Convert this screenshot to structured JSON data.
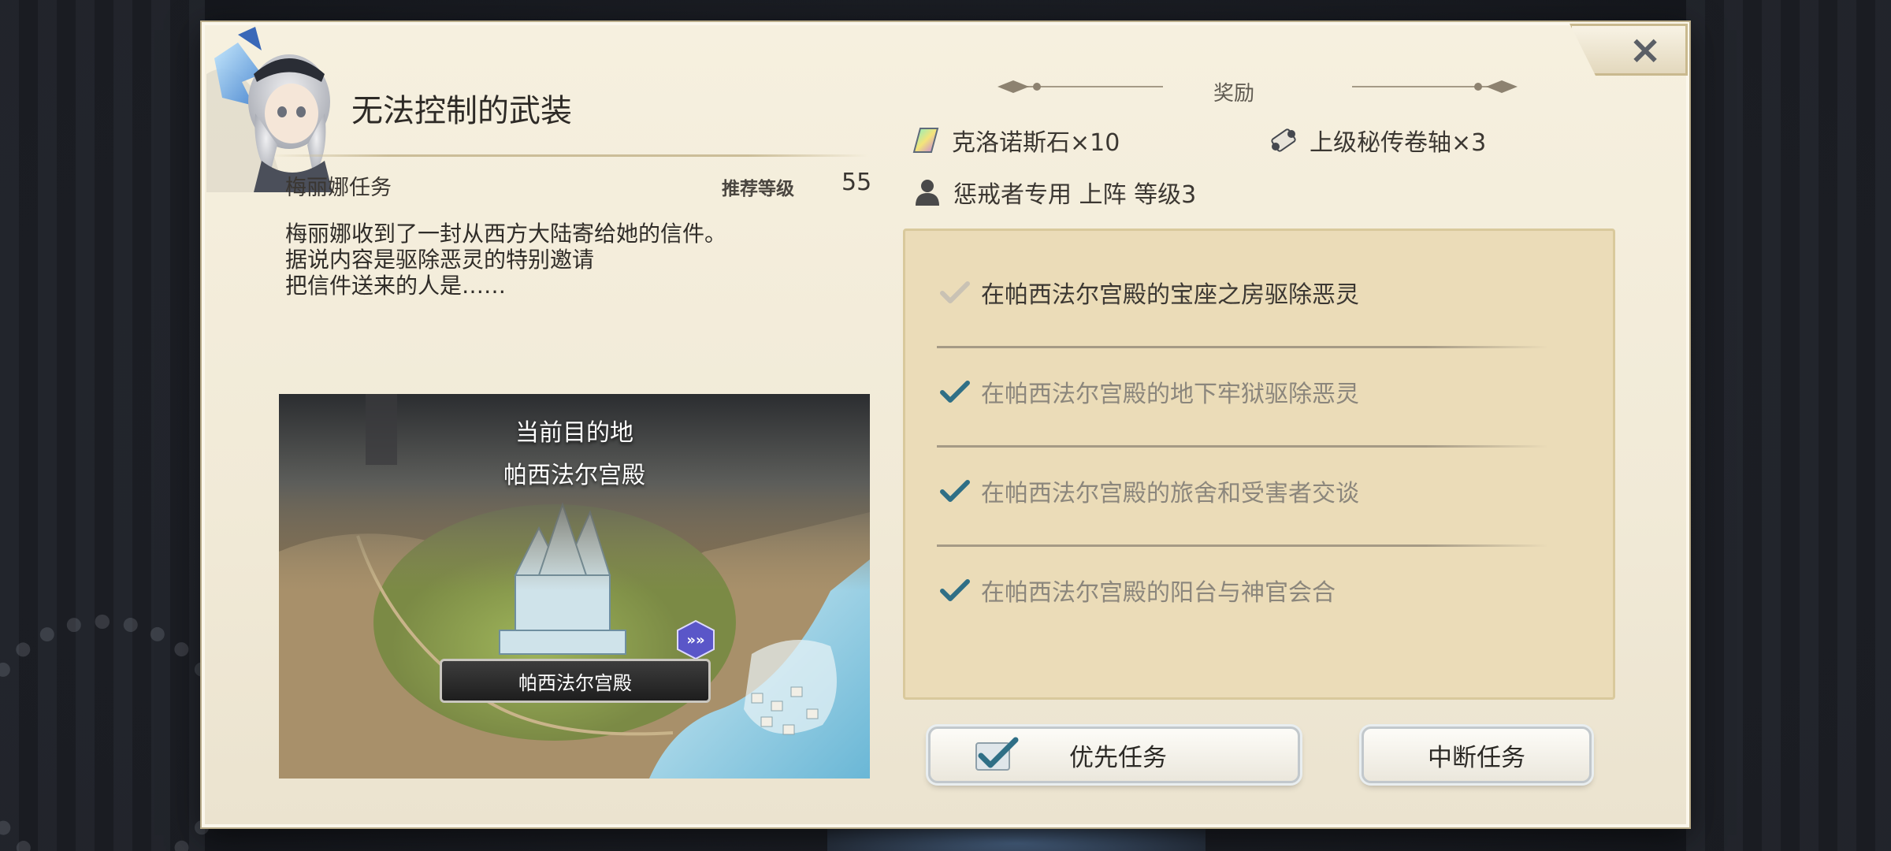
{
  "mission": {
    "title": "无法控制的武装",
    "quest_giver": "梅丽娜任务",
    "recommended_label": "推荐等级",
    "recommended_level": "55",
    "description": [
      "梅丽娜收到了一封从西方大陆寄给她的信件。",
      "据说内容是驱除恶灵的特别邀请",
      "把信件送来的人是……"
    ]
  },
  "map": {
    "heading": "当前目的地",
    "destination": "帕西法尔宫殿",
    "pin_label": "帕西法尔宫殿"
  },
  "rewards": {
    "title": "奖励",
    "items": [
      {
        "label": "克洛诺斯石×10",
        "icon": "chronos-stone-icon"
      },
      {
        "label": "上级秘传卷轴×3",
        "icon": "scroll-icon"
      },
      {
        "label": "惩戒者专用 上阵 等级3",
        "icon": "person-icon"
      }
    ]
  },
  "objectives": [
    {
      "text": "在帕西法尔宫殿的宝座之房驱除恶灵",
      "state": "current"
    },
    {
      "text": "在帕西法尔宫殿的地下牢狱驱除恶灵",
      "state": "done"
    },
    {
      "text": "在帕西法尔宫殿的旅舍和受害者交谈",
      "state": "done"
    },
    {
      "text": "在帕西法尔宫殿的阳台与神官会合",
      "state": "done"
    }
  ],
  "buttons": {
    "priority": "优先任务",
    "abort": "中断任务",
    "close": "×"
  },
  "colors": {
    "panel_bg": "#f3ecd9",
    "objectives_bg": "#ebdcb8",
    "check_done": "#2f6f86",
    "check_current": "#c9c2b4"
  }
}
